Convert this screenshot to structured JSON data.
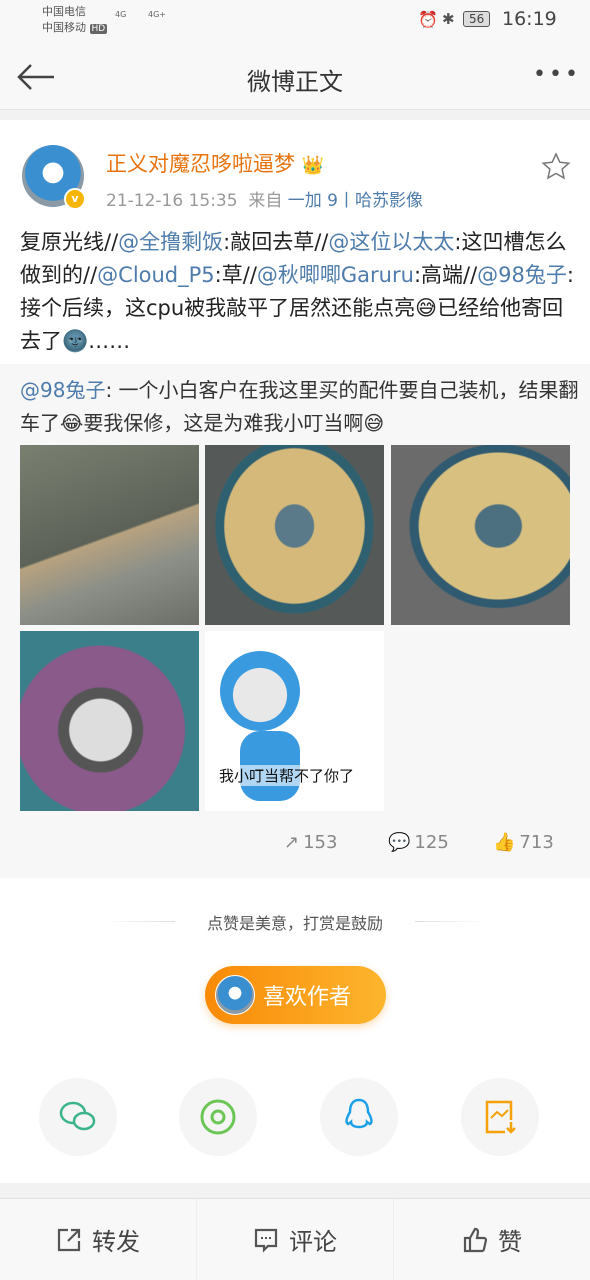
{
  "status_bar": {
    "carrier1": "中国电信",
    "carrier2": "中国移动",
    "hd": "HD",
    "net1": "4G",
    "net2": "4G+",
    "battery": "56",
    "time": "16:19"
  },
  "nav": {
    "title": "微博正文"
  },
  "post": {
    "author": "正义对魔忍哆啦逼梦",
    "timestamp": "21-12-16 15:35",
    "from_label": "来自",
    "source": "一加 9丨哈苏影像",
    "body": [
      {
        "t": "复原光线//"
      },
      {
        "t": "@全撸剩饭",
        "m": true
      },
      {
        "t": ":敲回去草//"
      },
      {
        "t": "@这位以太太",
        "m": true
      },
      {
        "t": ":这凹槽怎么做到的//"
      },
      {
        "t": "@Cloud_P5",
        "m": true
      },
      {
        "t": ":草//"
      },
      {
        "t": "@秋唧唧Garuru",
        "m": true
      },
      {
        "t": ":高端//"
      },
      {
        "t": "@98兔子",
        "m": true
      },
      {
        "t": ":接个后续，这cpu被我敲平了居然还能点亮😅已经给他寄回去了🌚……"
      }
    ],
    "retweet": {
      "author": "@98兔子",
      "text": ": 一个小白客户在我这里买的配件要自己装机，结果翻车了😂要我保修，这是为难我小叮当啊😅",
      "meme_caption": "我小叮当帮不了你了"
    },
    "stats": {
      "reposts": "153",
      "comments": "125",
      "likes": "713"
    }
  },
  "reward": {
    "tagline": "点赞是美意，打赏是鼓励",
    "button": "喜欢作者"
  },
  "share": [
    "wechat",
    "moments",
    "qq",
    "save-image"
  ],
  "bottom": {
    "repost": "转发",
    "comment": "评论",
    "like": "赞"
  },
  "colors": {
    "accent": "#f98a07",
    "name": "#e8740f",
    "link": "#4e7cab"
  }
}
